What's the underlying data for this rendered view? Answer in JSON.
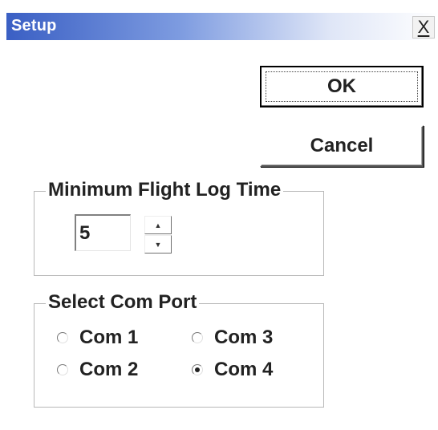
{
  "window": {
    "title": "Setup",
    "close_label": "X"
  },
  "buttons": {
    "ok_label": "OK",
    "cancel_label": "Cancel"
  },
  "flight_log": {
    "legend": "Minimum Flight Log Time",
    "value": "5",
    "spin_up_glyph": "▲",
    "spin_down_glyph": "▼"
  },
  "com_port": {
    "legend": "Select Com Port",
    "options": [
      {
        "label": "Com 1",
        "selected": false
      },
      {
        "label": "Com 2",
        "selected": false
      },
      {
        "label": "Com 3",
        "selected": false
      },
      {
        "label": "Com 4",
        "selected": true
      }
    ]
  },
  "colors": {
    "titlebar_start": "#3a5fc4",
    "titlebar_end": "#ffffff",
    "title_text": "#ffffff",
    "background": "#ffffff"
  }
}
